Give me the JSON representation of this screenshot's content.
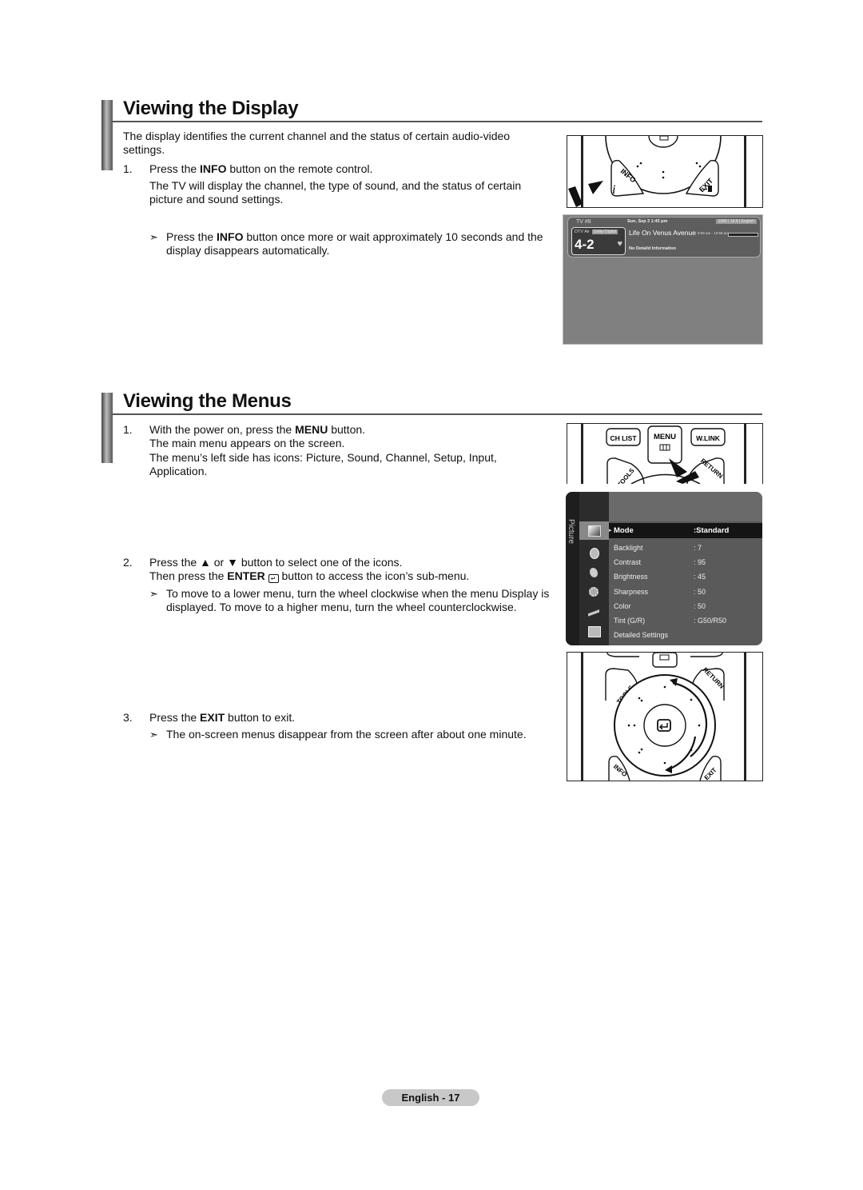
{
  "sections": [
    {
      "title": "Viewing the Display",
      "intro": "The display identifies the current channel and the status of certain audio-video settings.",
      "steps": [
        {
          "number": "1.",
          "line1_pre": "Press the ",
          "line1_bold": "INFO",
          "line1_post": " button on the remote control.",
          "line2": "The TV will display the channel, the type of sound, and the status of certain picture and sound settings."
        }
      ],
      "note": {
        "pre": "Press the ",
        "bold": "INFO",
        "post": " button once more or wait approximately 10 seconds and the display disappears automatically."
      }
    },
    {
      "title": "Viewing the Menus",
      "steps": [
        {
          "number": "1.",
          "line1_pre": "With the power on, press the ",
          "line1_bold": "MENU",
          "line1_post": " button.",
          "line2": "The main menu appears on the screen.",
          "line3": "The menu’s left side has icons: Picture, Sound, Channel, Setup, Input, Application."
        },
        {
          "number": "2.",
          "line1": "Press the ▲ or ▼ button to select one of the icons.",
          "line2_pre": "Then press the ",
          "line2_bold": "ENTER",
          "line2_post": " button to access the icon’s sub-menu.",
          "note": "To move to a lower menu, turn the wheel clockwise when the menu Display is displayed. To move to a higher menu, turn the wheel counterclockwise."
        },
        {
          "number": "3.",
          "line1_pre": "Press the ",
          "line1_bold": "EXIT",
          "line1_post": " button to exit.",
          "note": "The on-screen menus disappear from the screen after about one minute."
        }
      ]
    }
  ],
  "arrow_glyph": "➣",
  "remote": {
    "info_label": "INFO",
    "exit_label": "EXIT",
    "tools_label": "TOOLS",
    "return_label": "RETURN",
    "ch_list_label": "CH LIST",
    "menu_label": "MENU",
    "wlink_label": "W.LINK"
  },
  "info_osd": {
    "tv_number": "TV #8",
    "date_time": "Sun, Sep 3 1:45 pm",
    "format_badge": "1080 | 16:9 | English",
    "source": "DTV Air",
    "audio_badge": "Dolby Digital",
    "channel": "4-2",
    "program": "Life On Venus Avenue",
    "program_time": "9:59 am - 10:59 am",
    "details": "No Detaild Information"
  },
  "menu_osd": {
    "category": "Picture",
    "icons": [
      "picture-icon",
      "sound-icon",
      "channel-icon",
      "setup-icon",
      "input-icon",
      "application-icon"
    ],
    "rows": [
      {
        "label": "Mode",
        "value": ":Standard",
        "selected": true
      },
      {
        "label": "Backlight",
        "value": ": 7"
      },
      {
        "label": "Contrast",
        "value": ": 95"
      },
      {
        "label": "Brightness",
        "value": ": 45"
      },
      {
        "label": "Sharpness",
        "value": ": 50"
      },
      {
        "label": "Color",
        "value": ": 50"
      },
      {
        "label": "Tint (G/R)",
        "value": ": G50/R50"
      },
      {
        "label": "Detailed Settings",
        "value": ""
      }
    ]
  },
  "footer": {
    "page_label": "English - 17"
  }
}
